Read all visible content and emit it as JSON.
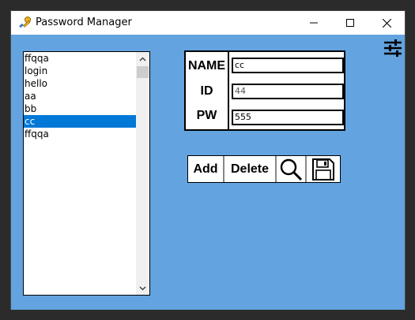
{
  "window": {
    "title": "Password Manager",
    "icon": "key-icon"
  },
  "titlebar_buttons": {
    "minimize_icon": "minimize-icon",
    "maximize_icon": "maximize-icon",
    "close_icon": "close-icon"
  },
  "colors": {
    "client_bg": "#62a3e0",
    "selection": "#0078d7"
  },
  "list": {
    "items": [
      "ffqqa",
      "login",
      "hello",
      "aa",
      "bb",
      "cc",
      "ffqqa"
    ],
    "selected_index": 5
  },
  "form": {
    "name_label": "NAME",
    "id_label": "ID",
    "pw_label": "PW",
    "name_value": "cc",
    "id_value": "44",
    "pw_value": "555"
  },
  "buttons": {
    "add_label": "Add",
    "delete_label": "Delete",
    "search_icon": "search-icon",
    "save_icon": "save-icon"
  },
  "settings": {
    "icon": "sliders-icon"
  }
}
